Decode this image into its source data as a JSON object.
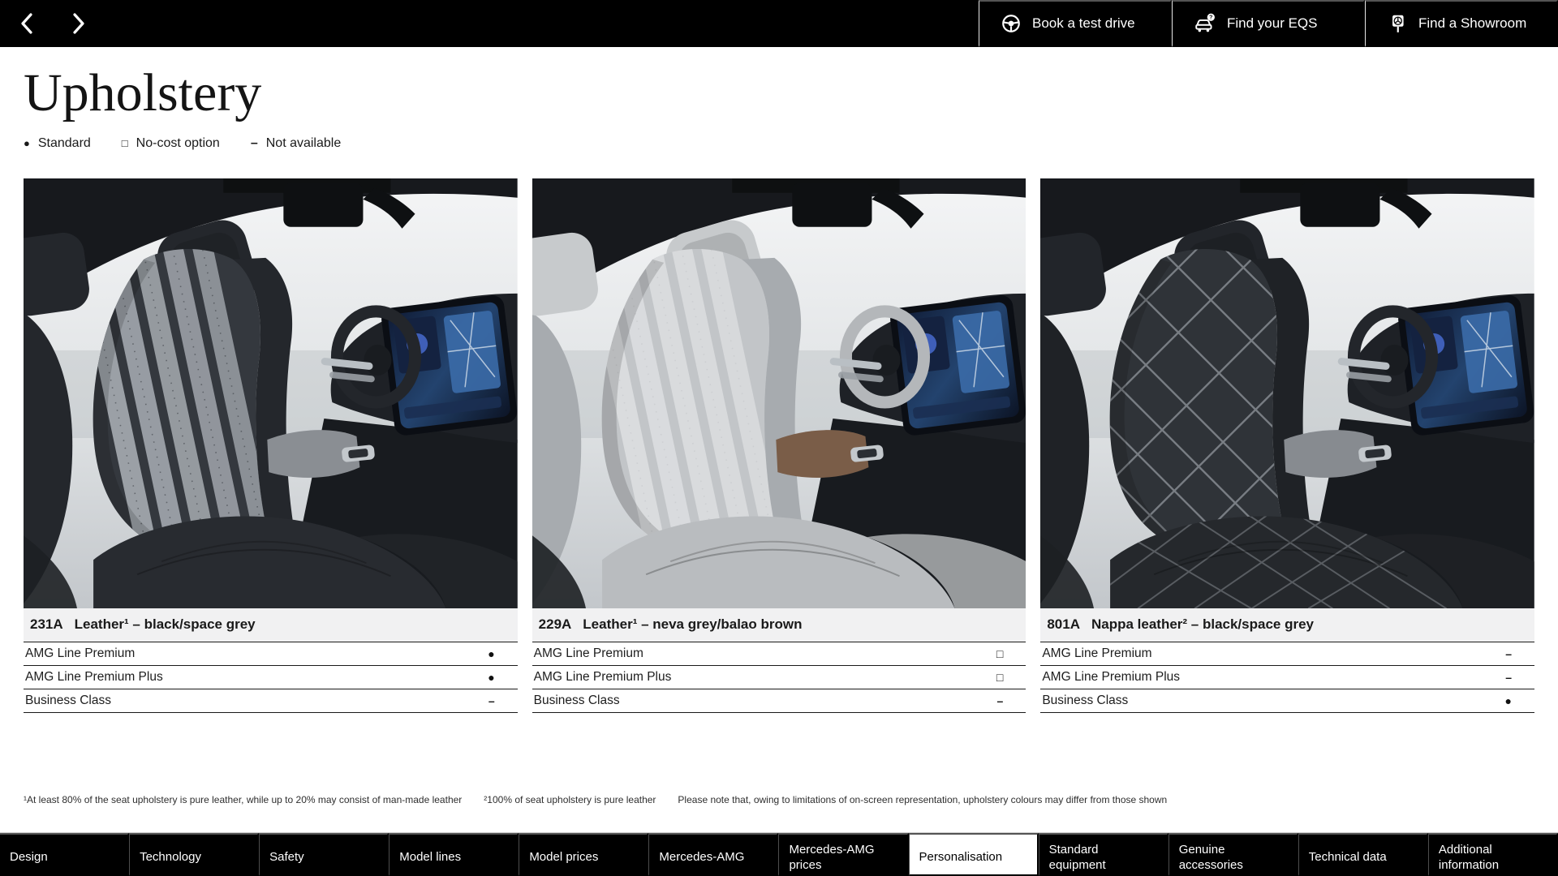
{
  "top_bar": {
    "actions": [
      {
        "icon": "steering-wheel-icon",
        "label": "Book a test drive"
      },
      {
        "icon": "car-question-icon",
        "label": "Find your EQS"
      },
      {
        "icon": "showroom-sign-icon",
        "label": "Find a Showroom"
      }
    ]
  },
  "page": {
    "title": "Upholstery",
    "legend": [
      {
        "symbol": "●",
        "label": "Standard"
      },
      {
        "symbol": "□",
        "label": "No-cost option"
      },
      {
        "symbol": "–",
        "label": "Not available"
      }
    ]
  },
  "upholstery": {
    "cards": [
      {
        "code": "231A",
        "name": "Leather¹ – black/space grey",
        "art": {
          "pattern": "stripes",
          "seat": "#34383e",
          "seat_dark": "#24272c",
          "insert": "#9ba0a6",
          "cushion": "#282b30",
          "console": "#8a8e93",
          "head": "#24272c",
          "wheel": "#23262b"
        },
        "rows": [
          {
            "label": "AMG Line Premium",
            "symbol": "●",
            "availability": "standard"
          },
          {
            "label": "AMG Line Premium Plus",
            "symbol": "●",
            "availability": "standard"
          },
          {
            "label": "Business Class",
            "symbol": "–",
            "availability": "not-available"
          }
        ]
      },
      {
        "code": "229A",
        "name": "Leather¹ – neva grey/balao brown",
        "art": {
          "pattern": "stripes",
          "seat": "#c2c5c8",
          "seat_dark": "#a7abaf",
          "insert": "#dadcde",
          "cushion": "#b9bcbf",
          "console": "#7a5d48",
          "head": "#c7cacc",
          "wheel": "#b4b7ba"
        },
        "rows": [
          {
            "label": "AMG Line Premium",
            "symbol": "□",
            "availability": "no-cost-option"
          },
          {
            "label": "AMG Line Premium Plus",
            "symbol": "□",
            "availability": "no-cost-option"
          },
          {
            "label": "Business Class",
            "symbol": "–",
            "availability": "not-available"
          }
        ]
      },
      {
        "code": "801A",
        "name": "Nappa leather² – black/space grey",
        "art": {
          "pattern": "diamond",
          "seat": "#2f3338",
          "seat_dark": "#1f2226",
          "insert": "#8b9096",
          "cushion": "#25282c",
          "console": "#878b90",
          "head": "#22252a",
          "wheel": "#23262b"
        },
        "rows": [
          {
            "label": "AMG Line Premium",
            "symbol": "–",
            "availability": "not-available"
          },
          {
            "label": "AMG Line Premium Plus",
            "symbol": "–",
            "availability": "not-available"
          },
          {
            "label": "Business Class",
            "symbol": "●",
            "availability": "standard"
          }
        ]
      }
    ]
  },
  "footnotes": [
    "¹At least 80% of the seat upholstery is pure leather, while up to 20% may consist of man-made leather",
    "²100% of seat upholstery is pure leather",
    "Please note that, owing to limitations of on-screen representation, upholstery colours may differ from those shown"
  ],
  "bottom_nav": {
    "tabs": [
      {
        "label": "Design",
        "active": false
      },
      {
        "label": "Technology",
        "active": false
      },
      {
        "label": "Safety",
        "active": false
      },
      {
        "label": "Model lines",
        "active": false
      },
      {
        "label": "Model prices",
        "active": false
      },
      {
        "label": "Mercedes-AMG",
        "active": false
      },
      {
        "label": "Mercedes-AMG prices",
        "active": false
      },
      {
        "label": "Personalisation",
        "active": true
      },
      {
        "label": "Standard equipment",
        "active": false
      },
      {
        "label": "Genuine accessories",
        "active": false
      },
      {
        "label": "Technical data",
        "active": false
      },
      {
        "label": "Additional information",
        "active": false
      }
    ]
  }
}
